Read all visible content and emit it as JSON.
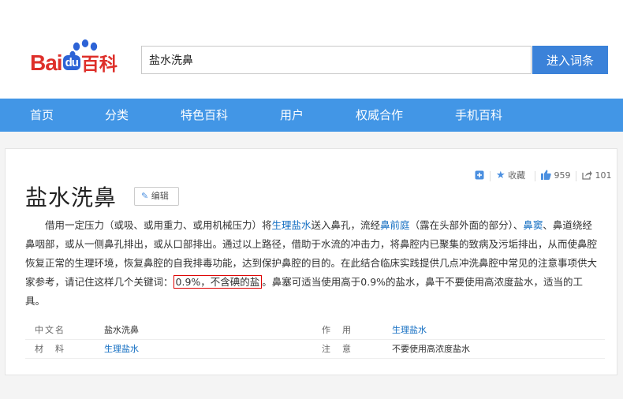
{
  "logo": {
    "bai": "Bai",
    "du": "du",
    "baike": "百科"
  },
  "search": {
    "value": "盐水洗鼻",
    "button": "进入词条"
  },
  "nav": [
    "首页",
    "分类",
    "特色百科",
    "用户",
    "权威合作",
    "手机百科"
  ],
  "tools": {
    "favorite": "收藏",
    "like_count": "959",
    "share_count": "101"
  },
  "entry": {
    "title": "盐水洗鼻",
    "edit": "编辑",
    "summary": {
      "t1": "借用一定压力（或吸、或用重力、或用机械压力）将",
      "l1": "生理盐水",
      "t2": "送入鼻孔，流经",
      "l2": "鼻前庭",
      "t3": "（露在头部外面的部分）、",
      "l3": "鼻窦",
      "t4": "、鼻道绕经鼻咽部，或从一侧鼻孔排出，或从口部排出。通过以上路径，借助于水流的冲击力，将鼻腔内已聚集的致病及污垢排出，从而使鼻腔恢复正常的生理环境，恢复鼻腔的自我排毒功能，达到保护鼻腔的目的。在此结合临床实践提供几点冲洗鼻腔中常见的注意事项供大家参考，请记住这样几个关键词：",
      "highlight": "0.9%，不含碘的盐",
      "t5": "。鼻塞可适当使用高于0.9%的盐水，鼻干不要使用高浓度盐水，适当的工具。"
    },
    "basic_info": [
      {
        "label": "中文名",
        "value": "盐水洗鼻",
        "label2": "作　用",
        "value2": "生理盐水"
      },
      {
        "label": "材　料",
        "value": "生理盐水",
        "label2": "注　意",
        "value2": "不要使用高浓度盐水"
      }
    ]
  },
  "colors": {
    "nav": "#4296e6",
    "button": "#3b82d9",
    "link": "#136ec2",
    "brand_red": "#de2f2a",
    "highlight_border": "#dd0000"
  }
}
